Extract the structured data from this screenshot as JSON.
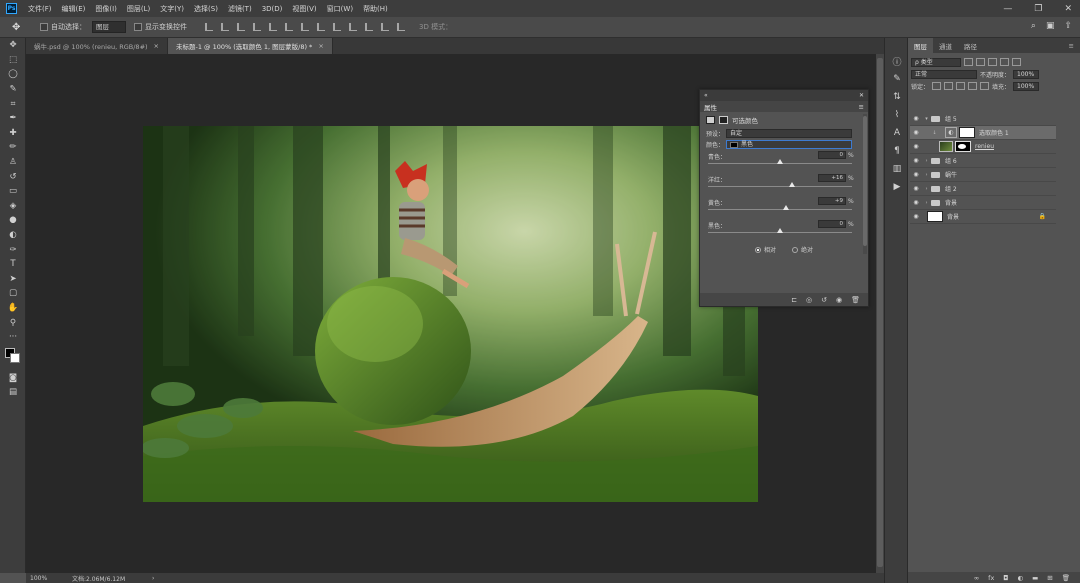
{
  "menubar": {
    "logo": "Ps",
    "items": [
      "文件(F)",
      "编辑(E)",
      "图像(I)",
      "图层(L)",
      "文字(Y)",
      "选择(S)",
      "滤镜(T)",
      "3D(D)",
      "视图(V)",
      "窗口(W)",
      "帮助(H)"
    ],
    "window_controls": [
      "—",
      "❐",
      "✕"
    ]
  },
  "options": {
    "auto_select_label": "自动选择：",
    "auto_select_value": "图层",
    "show_transform_label": "显示变换控件",
    "mode_3d_label": "3D 模式："
  },
  "tabs": [
    {
      "label": "蜗牛.psd @ 100% (renieu, RGB/8#)",
      "close": "×",
      "active": false
    },
    {
      "label": "未标题-1 @ 100% (选取颜色 1, 图层蒙版/8) *",
      "close": "×",
      "active": true
    }
  ],
  "status": {
    "zoom": "100%",
    "doc": "文档:2.06M/6.12M",
    "arrow": "›"
  },
  "properties": {
    "header_tab": "属性",
    "title": "可选颜色",
    "preset_label": "预设：",
    "preset_value": "自定",
    "colors_label": "颜色：",
    "colors_value": "黑色",
    "sliders": [
      {
        "name": "青色：",
        "value": "0",
        "unit": "%",
        "level": 0.5
      },
      {
        "name": "洋红：",
        "value": "+16",
        "unit": "%",
        "level": 0.58
      },
      {
        "name": "黄色：",
        "value": "+9",
        "unit": "%",
        "level": 0.545
      },
      {
        "name": "黑色：",
        "value": "0",
        "unit": "%",
        "level": 0.5
      }
    ],
    "radio_relative": "相对",
    "radio_absolute": "绝对"
  },
  "layers": {
    "tabs": [
      "图层",
      "通道",
      "路径"
    ],
    "filter_label": "ρ 类型",
    "blend_mode": "正常",
    "opacity_label": "不透明度：",
    "opacity_value": "100%",
    "lock_label": "锁定：",
    "fill_label": "填充：",
    "fill_value": "100%",
    "items": [
      {
        "name": "组 5",
        "type": "group",
        "open": true
      },
      {
        "name": "选取颜色 1",
        "type": "adjustment",
        "selected": true
      },
      {
        "name": "renieu",
        "type": "image"
      },
      {
        "name": "组 6",
        "type": "group"
      },
      {
        "name": "蜗牛",
        "type": "group"
      },
      {
        "name": "组 2",
        "type": "group"
      },
      {
        "name": "背景",
        "type": "group"
      },
      {
        "name": "背景",
        "type": "background",
        "locked": true
      }
    ]
  }
}
